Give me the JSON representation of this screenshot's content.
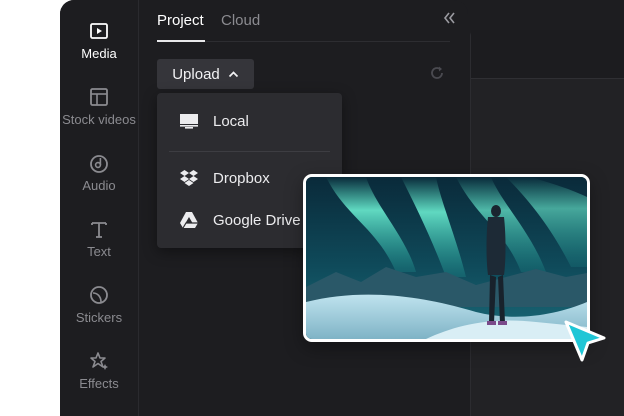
{
  "sidebar": {
    "items": [
      {
        "label": "Media",
        "icon": "media-icon",
        "active": true
      },
      {
        "label": "Stock videos",
        "icon": "stock-videos-icon",
        "active": false
      },
      {
        "label": "Audio",
        "icon": "audio-icon",
        "active": false
      },
      {
        "label": "Text",
        "icon": "text-icon",
        "active": false
      },
      {
        "label": "Stickers",
        "icon": "stickers-icon",
        "active": false
      },
      {
        "label": "Effects",
        "icon": "effects-icon",
        "active": false
      }
    ]
  },
  "panel": {
    "tabs": [
      {
        "label": "Project",
        "active": true
      },
      {
        "label": "Cloud",
        "active": false
      }
    ],
    "collapse_icon": "double-chevron-left-icon",
    "upload_label": "Upload",
    "upload_icon": "chevron-up-icon",
    "refresh_icon": "refresh-icon"
  },
  "upload_menu": {
    "items": [
      {
        "label": "Local",
        "icon": "monitor-icon"
      },
      {
        "label": "Dropbox",
        "icon": "dropbox-icon"
      },
      {
        "label": "Google Drive",
        "icon": "google-drive-icon"
      }
    ]
  },
  "preview": {
    "subject": "aurora-landscape-image"
  },
  "cursor": {
    "icon": "pointer-cursor-icon",
    "color": "#1fc6d6"
  },
  "colors": {
    "background": "#1d1d20",
    "accent": "#1fc6d6",
    "text_active": "#ffffff",
    "text_muted": "#8b8b90"
  }
}
